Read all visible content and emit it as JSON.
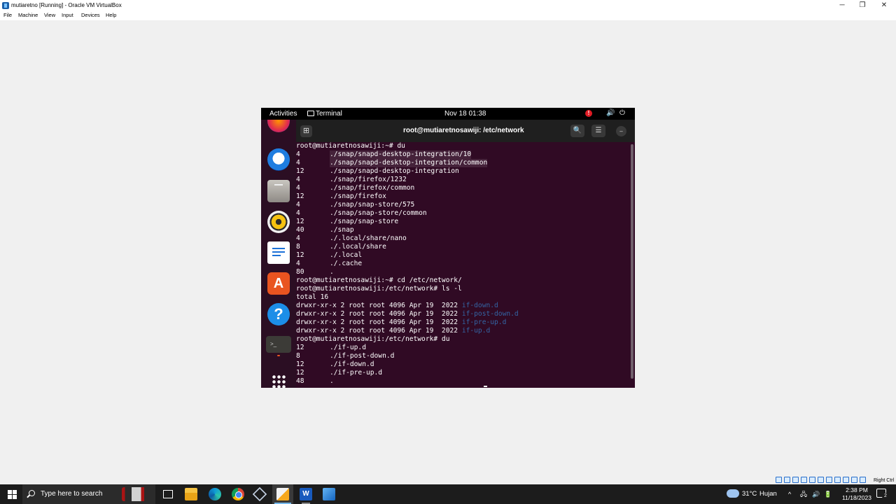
{
  "vbox": {
    "title": "mutiaretno [Running] - Oracle VM VirtualBox",
    "controls": {
      "minimize": "─",
      "restore": "❐",
      "close": "✕"
    },
    "menu": [
      "File",
      "Machine",
      "View",
      "Input",
      "Devices",
      "Help"
    ]
  },
  "gnome": {
    "activities": "Activities",
    "app_name": "Terminal",
    "clock": "Nov 18  01:38",
    "notification_badge": "!",
    "volume_icon": "🔊",
    "power_icon": "⏻"
  },
  "dock": {
    "items": [
      "firefox-icon",
      "thunderbird-icon",
      "files-icon",
      "rhythmbox-icon",
      "libreoffice-writer-icon",
      "app-center-icon",
      "help-icon",
      "terminal-icon",
      "show-apps-icon"
    ],
    "appcenter_glyph": "A",
    "help_glyph": "?",
    "terminal_glyph": ">_"
  },
  "terminal": {
    "title": "root@mutiaretnosawiji: /etc/network",
    "new_tab_glyph": "⊞",
    "search_glyph": "🔍",
    "menu_glyph": "☰",
    "minimize_glyph": "–",
    "maximize_glyph": "◻",
    "close_glyph": "✕",
    "lines": [
      {
        "text": "root@mutiaretnosawiji:~# du"
      },
      {
        "c1": "4",
        "c2": "./snap/snapd-desktop-integration/10",
        "hl": true
      },
      {
        "c1": "4",
        "c2": "./snap/snapd-desktop-integration/common",
        "hl": true
      },
      {
        "c1": "12",
        "c2": "./snap/snapd-desktop-integration"
      },
      {
        "c1": "4",
        "c2": "./snap/firefox/1232"
      },
      {
        "c1": "4",
        "c2": "./snap/firefox/common"
      },
      {
        "c1": "12",
        "c2": "./snap/firefox"
      },
      {
        "c1": "4",
        "c2": "./snap/snap-store/575"
      },
      {
        "c1": "4",
        "c2": "./snap/snap-store/common"
      },
      {
        "c1": "12",
        "c2": "./snap/snap-store"
      },
      {
        "c1": "40",
        "c2": "./snap"
      },
      {
        "c1": "4",
        "c2": "./.local/share/nano"
      },
      {
        "c1": "8",
        "c2": "./.local/share"
      },
      {
        "c1": "12",
        "c2": "./.local"
      },
      {
        "c1": "4",
        "c2": "./.cache"
      },
      {
        "c1": "80",
        "c2": "."
      },
      {
        "text": "root@mutiaretnosawiji:~# cd /etc/network/"
      },
      {
        "text": "root@mutiaretnosawiji:/etc/network# ls -l"
      },
      {
        "text": "total 16"
      },
      {
        "text": "drwxr-xr-x 2 root root 4096 Apr 19  2022 ",
        "dir": "if-down.d"
      },
      {
        "text": "drwxr-xr-x 2 root root 4096 Apr 19  2022 ",
        "dir": "if-post-down.d"
      },
      {
        "text": "drwxr-xr-x 2 root root 4096 Apr 19  2022 ",
        "dir": "if-pre-up.d"
      },
      {
        "text": "drwxr-xr-x 2 root root 4096 Apr 19  2022 ",
        "dir": "if-up.d"
      },
      {
        "text": "root@mutiaretnosawiji:/etc/network# du"
      },
      {
        "c1": "12",
        "c2": "./if-up.d"
      },
      {
        "c1": "8",
        "c2": "./if-post-down.d"
      },
      {
        "c1": "12",
        "c2": "./if-down.d"
      },
      {
        "c1": "12",
        "c2": "./if-pre-up.d"
      },
      {
        "c1": "48",
        "c2": "."
      }
    ]
  },
  "taskbar": {
    "search_placeholder": "Type here to search",
    "word_glyph": "W",
    "weather_temp": "31°C",
    "weather_desc": "Hujan",
    "tray_icons": [
      "^",
      "🖧",
      "🔊",
      "🔋"
    ],
    "time": "2:38 PM",
    "date": "11/18/2023",
    "notification_count": "2",
    "right_ctrl": "Right Ctrl"
  }
}
